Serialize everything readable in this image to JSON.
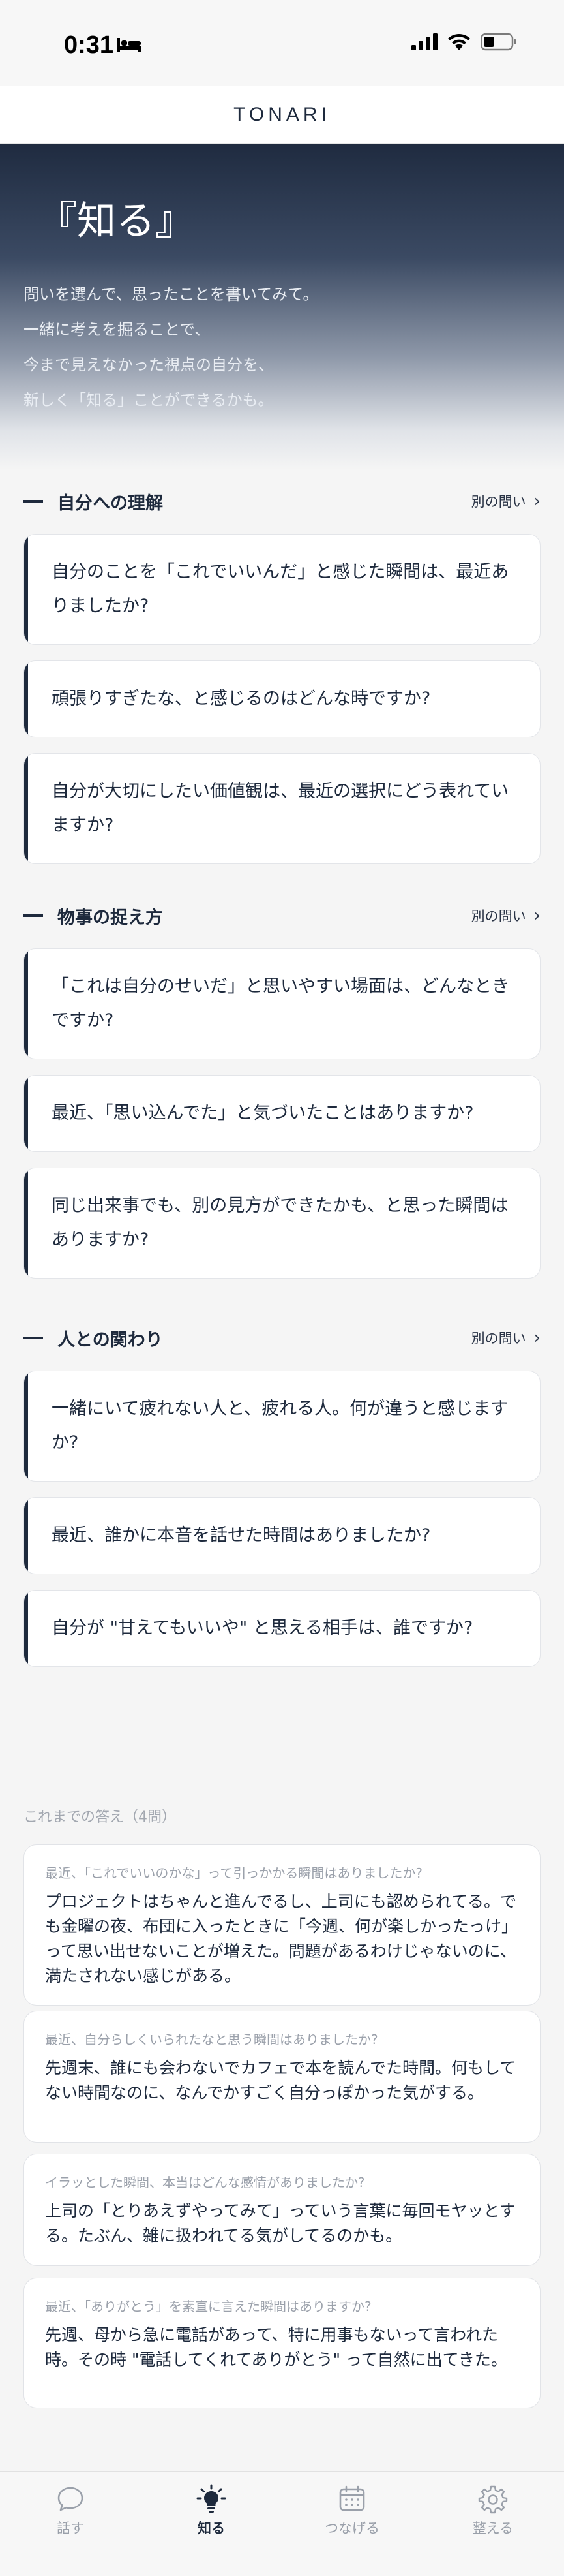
{
  "status": {
    "time": "0:31"
  },
  "app": {
    "title": "TONARI"
  },
  "hero": {
    "title": "『知る』",
    "lines": [
      "問いを選んで、思ったことを書いてみて。",
      "一緒に考えを掘ることで、",
      "今まで見えなかった視点の自分を、",
      "新しく「知る」ことができるかも。"
    ]
  },
  "sections": [
    {
      "title": "自分への理解",
      "more": "別の問い",
      "questions": [
        "自分のことを「これでいいんだ」と感じた瞬間は、最近ありましたか?",
        "頑張りすぎたな、と感じるのはどんな時ですか?",
        "自分が大切にしたい価値観は、最近の選択にどう表れていますか?"
      ]
    },
    {
      "title": "物事の捉え方",
      "more": "別の問い",
      "questions": [
        "「これは自分のせいだ」と思いやすい場面は、どんなときですか?",
        "最近、「思い込んでた」と気づいたことはありますか?",
        "同じ出来事でも、別の見方ができたかも、と思った瞬間はありますか?"
      ]
    },
    {
      "title": "人との関わり",
      "more": "別の問い",
      "questions": [
        "一緒にいて疲れない人と、疲れる人。何が違うと感じますか?",
        "最近、誰かに本音を話せた時間はありましたか?",
        "自分が \"甘えてもいいや\" と思える相手は、誰ですか?"
      ]
    }
  ],
  "answers": {
    "label": "これまでの答え（4問）",
    "items": [
      {
        "question": "最近、「これでいいのかな」って引っかかる瞬間はありましたか?",
        "answer": "プロジェクトはちゃんと進んでるし、上司にも認められてる。でも金曜の夜、布団に入ったときに「今週、何が楽しかったっけ」って思い出せないことが増えた。問題があるわけじゃないのに、満たされない感じがある。"
      },
      {
        "question": "最近、自分らしくいられたなと思う瞬間はありましたか?",
        "answer": "先週末、誰にも会わないでカフェで本を読んでた時間。何もしてない時間なのに、なんでかすごく自分っぽかった気がする。"
      },
      {
        "question": "イラッとした瞬間、本当はどんな感情がありましたか?",
        "answer": "上司の「とりあえずやってみて」っていう言葉に毎回モヤッとする。たぶん、雑に扱われてる気がしてるのかも。"
      },
      {
        "question": "最近、「ありがとう」を素直に言えた瞬間はありますか?",
        "answer": "先週、母から急に電話があって、特に用事もないって言われた時。その時 \"電話してくれてありがとう\" って自然に出てきた。"
      }
    ]
  },
  "tabs": [
    {
      "label": "話す",
      "icon": "chat-bubble-icon",
      "active": false
    },
    {
      "label": "知る",
      "icon": "lightbulb-icon",
      "active": true
    },
    {
      "label": "つなげる",
      "icon": "calendar-icon",
      "active": false
    },
    {
      "label": "整える",
      "icon": "gear-icon",
      "active": false
    }
  ],
  "colors": {
    "accent": "#1e2a3d",
    "background": "#f5f5f5"
  }
}
